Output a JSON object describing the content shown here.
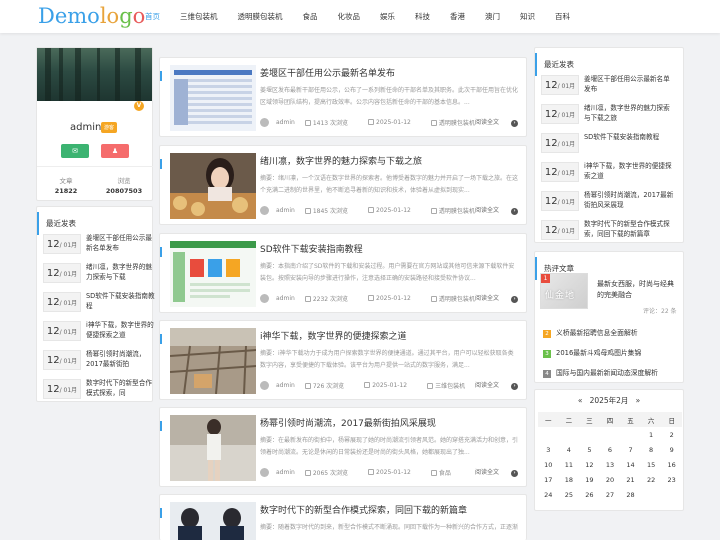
{
  "logo": [
    "Demo",
    "lo",
    "g",
    "o"
  ],
  "nav": [
    "首页",
    "三维包装机",
    "透明膜包装机",
    "食品",
    "化妆品",
    "娱乐",
    "科技",
    "香港",
    "澳门",
    "知识",
    "百科"
  ],
  "profile": {
    "name": "admin",
    "badge": "游客",
    "stats": [
      {
        "label": "文章",
        "value": "21822"
      },
      {
        "label": "浏览",
        "value": "20807503"
      }
    ]
  },
  "recent_title": "最近发表",
  "recent_left": [
    {
      "day": "12",
      "mon": "/ 01月",
      "title": "姜堰区干部任用公示最新名单发布"
    },
    {
      "day": "12",
      "mon": "/ 01月",
      "title": "绪川凛，数字世界的魅力探索与下载"
    },
    {
      "day": "12",
      "mon": "/ 01月",
      "title": "SD软件下载安装指南教程"
    },
    {
      "day": "12",
      "mon": "/ 01月",
      "title": "i神华下载，数字世界的便捷探索之道"
    },
    {
      "day": "12",
      "mon": "/ 01月",
      "title": "杨幂引领时尚潮流，2017最新街拍"
    },
    {
      "day": "12",
      "mon": "/ 01月",
      "title": "数字时代下的新型合作模式探索，同"
    }
  ],
  "recent_right": [
    {
      "day": "12",
      "mon": "/ 01月",
      "title": "姜堰区干部任用公示最新名单发布"
    },
    {
      "day": "12",
      "mon": "/ 01月",
      "title": "绪川凛，数字世界的魅力探索与下载之旅"
    },
    {
      "day": "12",
      "mon": "/ 01月",
      "title": "SD软件下载安装指南教程"
    },
    {
      "day": "12",
      "mon": "/ 01月",
      "title": "i神华下载，数字世界的便捷探索之道"
    },
    {
      "day": "12",
      "mon": "/ 01月",
      "title": "杨幂引领时尚潮流，2017最新街拍风采展现"
    },
    {
      "day": "12",
      "mon": "/ 01月",
      "title": "数字时代下的新型合作模式探索，同回下载的新篇章"
    }
  ],
  "hot": {
    "title": "热评文章",
    "tag": "1",
    "watermark": "仙金地",
    "first_title": "最新女西服，时尚与经典的完美融合",
    "first_comments": "评论：22 条",
    "items": [
      {
        "num": "2",
        "color": "#f5a623",
        "title": "义桥最新招聘信息全面解析"
      },
      {
        "num": "3",
        "color": "#6ac04a",
        "title": "2016最新斗鸡母鸡图片集锦"
      },
      {
        "num": "4",
        "color": "#888888",
        "title": "国际与国内最新新闻动态深度解析"
      }
    ]
  },
  "calendar": {
    "prev": "«",
    "month": "2025年2月",
    "next": "»",
    "weekdays": [
      "一",
      "二",
      "三",
      "四",
      "五",
      "六",
      "日"
    ],
    "rows": [
      [
        "",
        "",
        "",
        "",
        "",
        "1",
        "2"
      ],
      [
        "3",
        "4",
        "5",
        "6",
        "7",
        "8",
        "9"
      ],
      [
        "10",
        "11",
        "12",
        "13",
        "14",
        "15",
        "16"
      ],
      [
        "17",
        "18",
        "19",
        "20",
        "21",
        "22",
        "23"
      ],
      [
        "24",
        "25",
        "26",
        "27",
        "28",
        "",
        ""
      ]
    ]
  },
  "articles": [
    {
      "title": "姜堰区干部任用公示最新名单发布",
      "summary": "姜堰区发布最新干部任用公示，公布了一系列新任命的干部名单及其职务。此次干部任用旨在优化区域领导团队结构，提高行政效率。公示内容包括新任命的干部的基本信息。...",
      "author": "admin",
      "views": "1413 次浏览",
      "date": "2025-01-12",
      "category": "透明膜包装机",
      "more": "阅读全文"
    },
    {
      "title": "绪川凛，数字世界的魅力探索与下载之旅",
      "summary": "摘要：绪川凛，一个汉语在数字世界的探索者。他博受着数字的魅力并开启了一场下载之旅。在这个充满二进制的世界里，他不断追寻着新的知识和技术，体验着从虚拟到现实...",
      "author": "admin",
      "views": "1845 次浏览",
      "date": "2025-01-12",
      "category": "透明膜包装机",
      "more": "阅读全文"
    },
    {
      "title": "SD软件下载安装指南教程",
      "summary": "摘要：本指南介绍了SD软件的下载和安装过程。用户需要在官方网站或其他可信来源下载软件安装包。按照安装向导的步骤进行操作，注意选择正确的安装路径和接受软件协议...",
      "author": "admin",
      "views": "2232 次浏览",
      "date": "2025-01-12",
      "category": "透明膜包装机",
      "more": "阅读全文"
    },
    {
      "title": "i神华下载，数字世界的便捷探索之道",
      "summary": "摘要：i神华下载功力于成为用户探索数字世界的便捷通道。通过其平台，用户可以轻松获取各类数字内容，享受便捷的下载体验。该平台为用户提供一站式的数字服务，满足...",
      "author": "admin",
      "views": "726 次浏览",
      "date": "2025-01-12",
      "category": "三维包装机",
      "more": "阅读全文"
    },
    {
      "title": "杨幂引领时尚潮流，2017最新街拍风采展现",
      "summary": "摘要：在最新发布的街拍中，杨幂展现了她的时尚潮流引领者风范。她的穿搭充满活力和创意，引领着时尚潮流。无论是休闲的日常装扮还是时尚的街头风格，她都展现出了独...",
      "author": "admin",
      "views": "2065 次浏览",
      "date": "2025-01-12",
      "category": "食品",
      "more": "阅读全文"
    },
    {
      "title": "数字时代下的新型合作模式探索，同回下载的新篇章",
      "summary": "摘要：随着数字时代的到来，新型合作模式不断涌现。同回下载作为一种新兴的合作方式，正逐渐成为行业的焦点。这种模式通过数字技术实现资源共享和互利共赢，为...",
      "author": "admin",
      "views": "",
      "date": "",
      "category": "",
      "more": ""
    }
  ]
}
